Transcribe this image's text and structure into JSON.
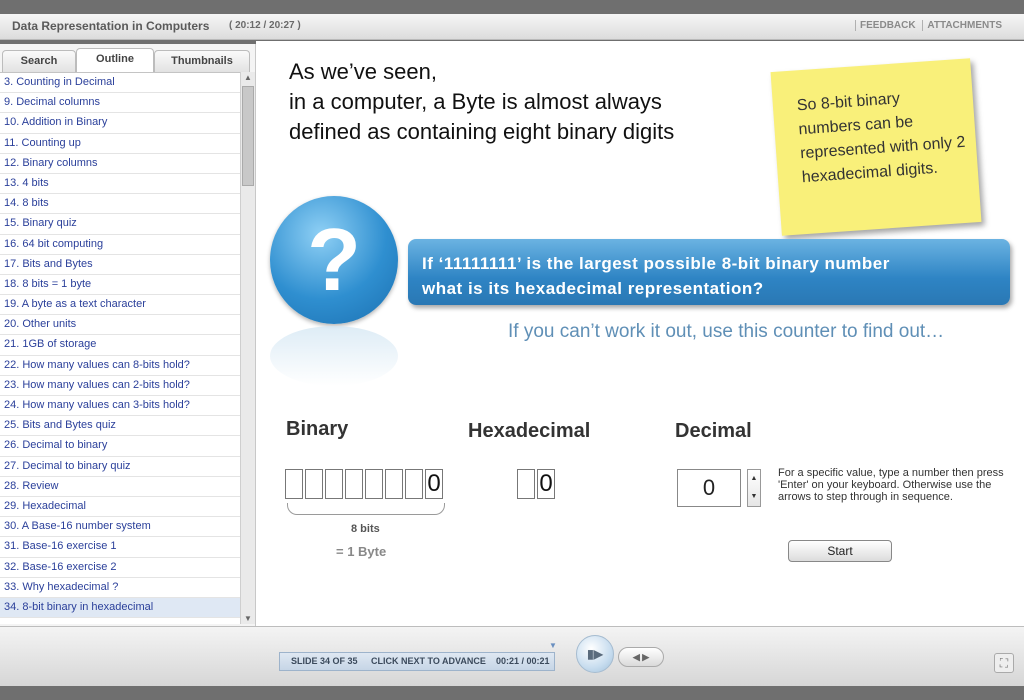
{
  "header": {
    "title": "Data Representation in Computers",
    "time": "( 20:12 / 20:27 )",
    "feedback": "FEEDBACK",
    "attachments": "ATTACHMENTS"
  },
  "sidebar": {
    "tabs": [
      "Search",
      "Outline",
      "Thumbnails"
    ],
    "items": [
      "3. Counting in Decimal",
      "9. Decimal columns",
      "10. Addition in Binary",
      "11. Counting up",
      "12. Binary columns",
      "13. 4 bits",
      "14. 8 bits",
      "15. Binary quiz",
      "16. 64 bit computing",
      "17. Bits and Bytes",
      "18. 8 bits = 1 byte",
      "19. A byte as a text character",
      "20. Other units",
      "21. 1GB of storage",
      "22. How many values can 8-bits hold?",
      "23. How many values can 2-bits hold?",
      "24. How many values can 3-bits hold?",
      "25. Bits and Bytes quiz",
      "26. Decimal to binary",
      "27. Decimal to binary quiz",
      "28. Review",
      "29. Hexadecimal",
      "30. A Base-16 number system",
      "31. Base-16 exercise 1",
      "32. Base-16 exercise 2",
      "33. Why hexadecimal ?",
      "34. 8-bit binary in hexadecimal"
    ]
  },
  "slide": {
    "intro_line1": "As we’ve seen,",
    "intro_line2": "in a computer, a Byte is almost always",
    "intro_line3": "defined as containing eight binary digits",
    "note": "So 8-bit binary numbers can be represented with only 2 hexadecimal digits.",
    "question_mark": "?",
    "question_line1": "If ‘11111111’ is the largest possible 8-bit binary number",
    "question_line2": "what is its hexadecimal representation?",
    "hint": "If you can’t work it out, use this counter to find out…",
    "binary_label": "Binary",
    "hex_label": "Hexadecimal",
    "decimal_label": "Decimal",
    "binary_digits": [
      "",
      "",
      "",
      "",
      "",
      "",
      "",
      "0"
    ],
    "hex_digits": [
      "",
      "0"
    ],
    "decimal_value": "0",
    "bits_label": "8 bits",
    "byte_label": "= 1 Byte",
    "help": "For a specific value, type a number then press 'Enter' on your keyboard. Otherwise use the arrows to step through in sequence.",
    "start": "Start"
  },
  "player": {
    "slide_status": "SLIDE 34 OF 35",
    "advance": "CLICK NEXT TO ADVANCE",
    "time": "00:21 / 00:21"
  }
}
